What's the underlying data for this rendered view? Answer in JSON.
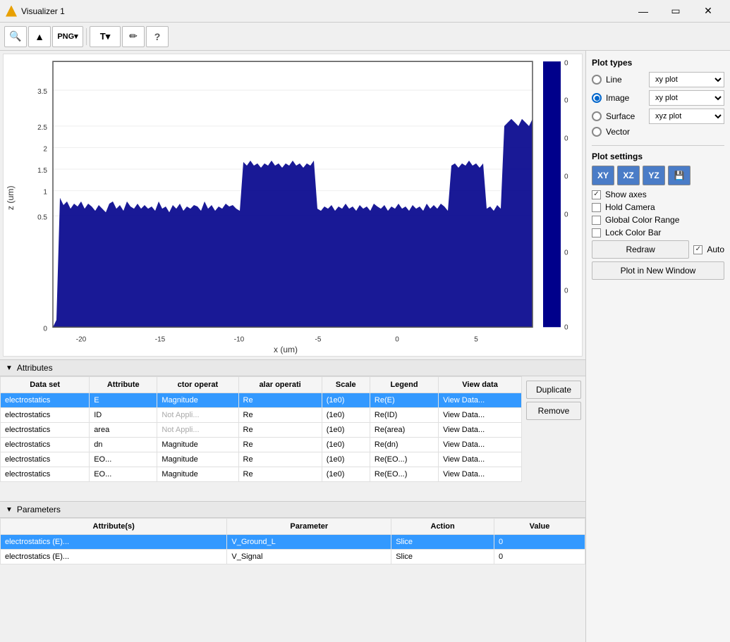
{
  "window": {
    "title": "Visualizer 1"
  },
  "toolbar": {
    "buttons": [
      {
        "name": "zoom-icon",
        "icon": "🔍"
      },
      {
        "name": "mountain-icon",
        "icon": "▲"
      },
      {
        "name": "png-icon",
        "icon": "PNG"
      },
      {
        "name": "text-icon",
        "icon": "T"
      },
      {
        "name": "pencil-icon",
        "icon": "✏"
      },
      {
        "name": "help-icon",
        "icon": "?"
      }
    ]
  },
  "plot": {
    "y_label": "z (um)",
    "x_label": "x (um)",
    "y_ticks": [
      "3.5",
      "2.5",
      "2",
      "1.5",
      "1",
      "0.5",
      "0"
    ],
    "x_ticks": [
      "-20",
      "-15",
      "-10",
      "-5",
      "0",
      "5"
    ],
    "colorbar_ticks": [
      "0",
      "0",
      "0",
      "0",
      "0",
      "0",
      "0",
      "0"
    ]
  },
  "attributes_section": {
    "title": "Attributes",
    "columns": [
      "Data set",
      "Attribute",
      "ctor operat",
      "alar operati",
      "Scale",
      "Legend",
      "View data"
    ],
    "rows": [
      {
        "dataset": "electrostatics",
        "attribute": "E",
        "ctor": "Magnitude",
        "alar": "Re",
        "scale": "(1e0)",
        "legend": "Re(E)",
        "viewdata": "View Data...",
        "selected": true
      },
      {
        "dataset": "electrostatics",
        "attribute": "ID",
        "ctor": "Not Appli...",
        "alar": "Re",
        "scale": "(1e0)",
        "legend": "Re(ID)",
        "viewdata": "View Data...",
        "selected": false,
        "light_ctor": true
      },
      {
        "dataset": "electrostatics",
        "attribute": "area",
        "ctor": "Not Appli...",
        "alar": "Re",
        "scale": "(1e0)",
        "legend": "Re(area)",
        "viewdata": "View Data...",
        "selected": false,
        "light_ctor": true
      },
      {
        "dataset": "electrostatics",
        "attribute": "dn",
        "ctor": "Magnitude",
        "alar": "Re",
        "scale": "(1e0)",
        "legend": "Re(dn)",
        "viewdata": "View Data...",
        "selected": false
      },
      {
        "dataset": "electrostatics",
        "attribute": "EO...",
        "ctor": "Magnitude",
        "alar": "Re",
        "scale": "(1e0)",
        "legend": "Re(EO...)",
        "viewdata": "View Data...",
        "selected": false,
        "partial": true
      }
    ],
    "side_buttons": [
      "Duplicate",
      "Remove"
    ]
  },
  "parameters_section": {
    "title": "Parameters",
    "columns": [
      "Attribute(s)",
      "Parameter",
      "Action",
      "Value"
    ],
    "rows": [
      {
        "attribute": "electrostatics (E)...",
        "parameter": "V_Ground_L",
        "action": "Slice",
        "value": "0",
        "selected": true
      },
      {
        "attribute": "electrostatics (E)...",
        "parameter": "V_Signal",
        "action": "Slice",
        "value": "0",
        "selected": false
      }
    ]
  },
  "right_panel": {
    "plot_types_title": "Plot types",
    "plot_type_rows": [
      {
        "label": "Line",
        "select": "xy plot",
        "selected": false
      },
      {
        "label": "Image",
        "select": "xy plot",
        "selected": true
      },
      {
        "label": "Surface",
        "select": "xyz plot",
        "selected": false
      },
      {
        "label": "Vector",
        "select": "",
        "selected": false
      }
    ],
    "plot_settings_title": "Plot settings",
    "axis_buttons": [
      "XY",
      "XZ",
      "YZ",
      "💾"
    ],
    "checkboxes": [
      {
        "label": "Show axes",
        "checked": true
      },
      {
        "label": "Hold Camera",
        "checked": false
      },
      {
        "label": "Global Color Range",
        "checked": false
      },
      {
        "label": "Lock Color Bar",
        "checked": false
      }
    ],
    "redraw_label": "Redraw",
    "auto_label": "Auto",
    "plot_new_label": "Plot in New Window"
  }
}
